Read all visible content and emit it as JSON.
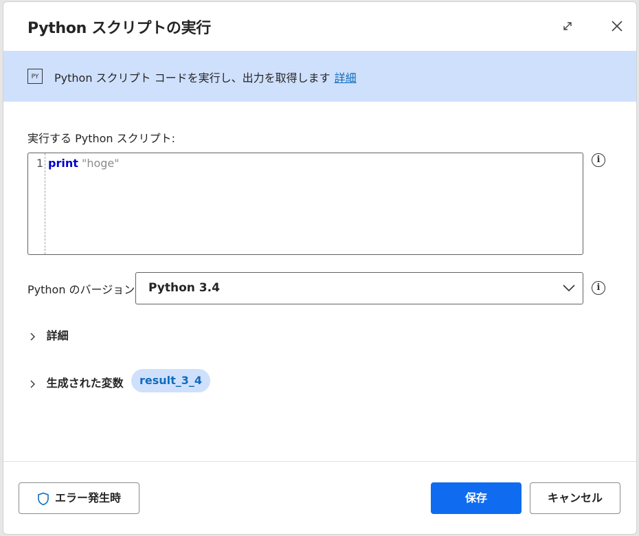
{
  "dialog": {
    "title": "Python スクリプトの実行"
  },
  "banner": {
    "icon_text": "PY",
    "description": "Python スクリプト コードを実行し、出力を取得します",
    "link": "詳細"
  },
  "script": {
    "label": "実行する Python スクリプト:",
    "line_number": "1",
    "keyword": "print",
    "string": "\"hoge\""
  },
  "version": {
    "label": "Python のバージョン:",
    "selected": "Python 3.4"
  },
  "advanced": {
    "label": "詳細"
  },
  "variables": {
    "label": "生成された変数",
    "chip": "result_3_4"
  },
  "footer": {
    "on_error": "エラー発生時",
    "save": "保存",
    "cancel": "キャンセル"
  },
  "colors": {
    "accent": "#0f6cf0",
    "banner_bg": "#cfe0fc",
    "link": "#0f6cbd",
    "keyword": "#0000cd"
  }
}
